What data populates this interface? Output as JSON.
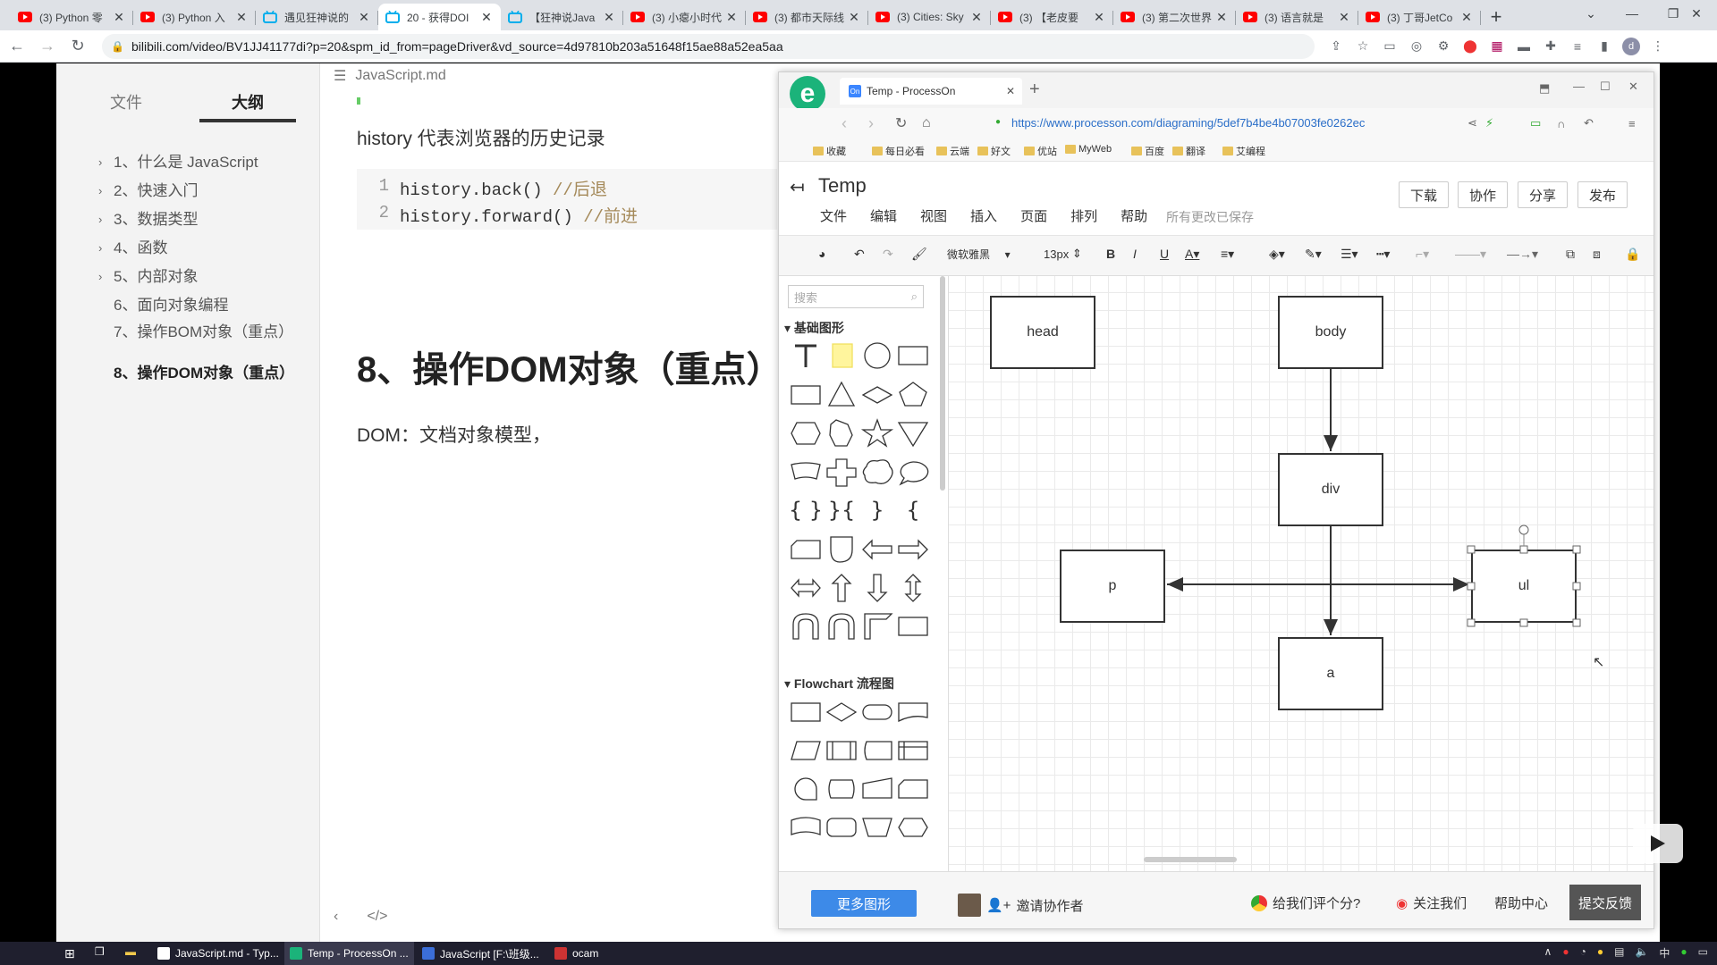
{
  "browser": {
    "tabs": [
      {
        "title": "(3) Python 零",
        "icon": "youtube-icon"
      },
      {
        "title": "(3) Python 入",
        "icon": "youtube-icon"
      },
      {
        "title": "遇见狂神说的",
        "icon": "bilibili-icon"
      },
      {
        "title": "20 - 获得DOI",
        "icon": "bilibili-icon",
        "active": true
      },
      {
        "title": "【狂神说Java",
        "icon": "bilibili-icon"
      },
      {
        "title": "(3) 小瘪小时代",
        "icon": "youtube-icon"
      },
      {
        "title": "(3) 都市天际线",
        "icon": "youtube-icon"
      },
      {
        "title": "(3) Cities: Sky",
        "icon": "youtube-icon"
      },
      {
        "title": "(3) 【老皮要",
        "icon": "youtube-icon"
      },
      {
        "title": "(3) 第二次世界",
        "icon": "youtube-icon"
      },
      {
        "title": "(3) 语言就是",
        "icon": "youtube-icon"
      },
      {
        "title": "(3) 丁哥JetCo",
        "icon": "youtube-icon"
      }
    ],
    "new_tab": "+",
    "url": "bilibili.com/video/BV1JJ41177di?p=20&spm_id_from=pageDriver&vd_source=4d97810b203a51648f15ae88a52ea5aa"
  },
  "typora": {
    "sidebar_tabs": [
      "文件",
      "大纲"
    ],
    "outline": [
      {
        "label": "1、什么是 JavaScript",
        "caret": "›"
      },
      {
        "label": "2、快速入门",
        "caret": "›"
      },
      {
        "label": "3、数据类型",
        "caret": "›"
      },
      {
        "label": "4、函数",
        "caret": "›"
      },
      {
        "label": "5、内部对象",
        "caret": "›"
      },
      {
        "label": "6、面向对象编程",
        "caret": ""
      },
      {
        "label": "7、操作BOM对象（重点）",
        "caret": ""
      },
      {
        "label": "8、操作DOM对象（重点）",
        "caret": "",
        "current": true
      }
    ],
    "file_name": "JavaScript.md",
    "para1": "history 代表浏览器的历史记录",
    "code_lines": [
      {
        "num": "1",
        "code": "history.back() ",
        "comment": "//后退"
      },
      {
        "num": "2",
        "code": "history.forward() ",
        "comment": "//前进"
      }
    ],
    "heading": "8、操作DOM对象（重点）",
    "para2": "DOM：文档对象模型，",
    "footer_left": "‹",
    "footer_code": "</>"
  },
  "processon": {
    "tab_title": "Temp - ProcessOn",
    "url": "https://www.processon.com/diagraming/5def7b4be4b07003fe0262ec",
    "bookmarks": [
      "收藏",
      "每日必看",
      "云端",
      "好文",
      "优站",
      "MyWeb",
      "百度",
      "翻译",
      "艾编程"
    ],
    "title": "Temp",
    "menu": [
      "文件",
      "编辑",
      "视图",
      "插入",
      "页面",
      "排列",
      "帮助"
    ],
    "saved_status": "所有更改已保存",
    "actions": [
      "下载",
      "协作",
      "分享",
      "发布"
    ],
    "font_name": "微软雅黑",
    "font_size": "13px",
    "search_placeholder": "搜索",
    "section_basic": "基础图形",
    "section_flowchart": "Flowchart 流程图",
    "nodes": {
      "head": "head",
      "body": "body",
      "div": "div",
      "p": "p",
      "ul": "ul",
      "a": "a"
    },
    "more_shapes": "更多图形",
    "invite": "邀请协作者",
    "rate": "给我们评个分?",
    "follow": "关注我们",
    "help": "帮助中心",
    "feedback": "提交反馈"
  },
  "taskbar": {
    "apps": [
      {
        "label": "JavaScript.md - Typ..."
      },
      {
        "label": "Temp - ProcessOn ..."
      },
      {
        "label": "JavaScript [F:\\班级..."
      },
      {
        "label": "ocam"
      }
    ],
    "ime": "中"
  },
  "colors": {
    "accent": "#3d8ae8",
    "bilibili": "#00aeec",
    "youtube": "#ff0000"
  }
}
